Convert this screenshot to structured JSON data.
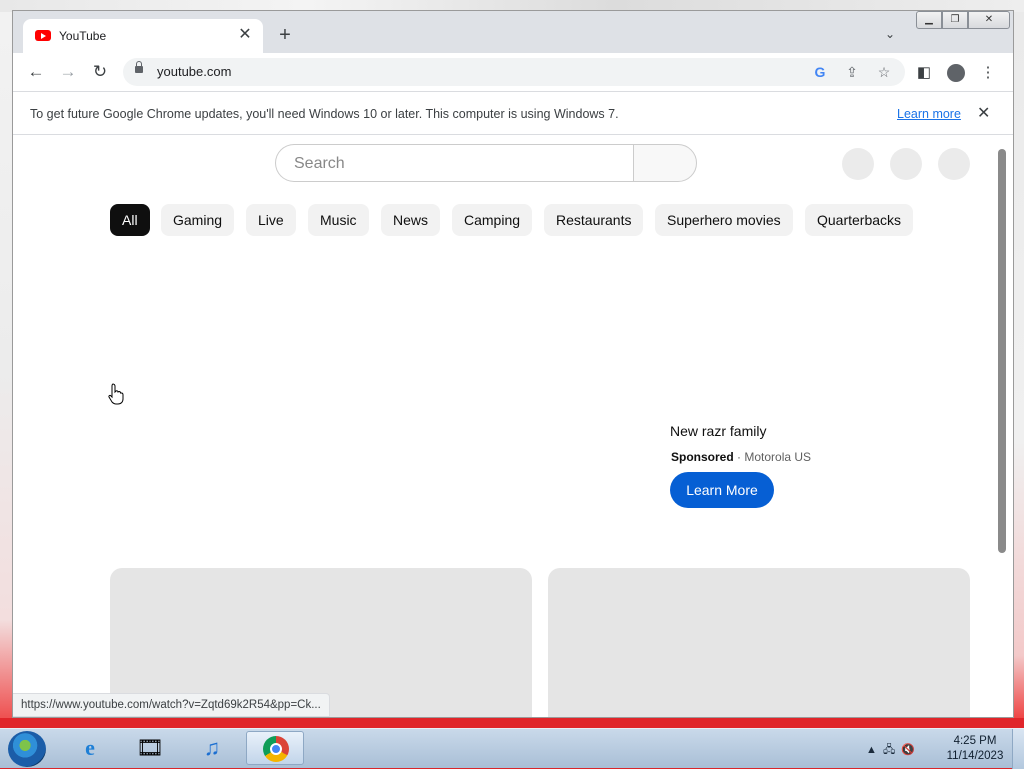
{
  "browser": {
    "tab": {
      "title": "YouTube"
    },
    "address_bar": {
      "url": "youtube.com"
    },
    "infobar": {
      "message": "To get future Google Chrome updates, you'll need Windows 10 or later. This computer is using Windows 7.",
      "link": "Learn more"
    },
    "status_url": "https://www.youtube.com/watch?v=Zqtd69k2R54&pp=Ck..."
  },
  "youtube": {
    "search": {
      "placeholder": "Search",
      "value": ""
    },
    "chips": [
      "All",
      "Gaming",
      "Live",
      "Music",
      "News",
      "Camping",
      "Restaurants",
      "Superhero movies",
      "Quarterbacks"
    ],
    "active_chip": "All",
    "ad": {
      "title": "New razr family",
      "sponsored": "Sponsored",
      "separator": "·",
      "advertiser": "Motorola US",
      "cta": "Learn More"
    }
  },
  "taskbar": {
    "time": "4:25 PM",
    "date": "11/14/2023"
  },
  "colors": {
    "youtube_blue": "#065fd4",
    "chrome_link": "#1a73e8",
    "chip_active_bg": "#0f0f0f",
    "desktop_red": "#d9262b"
  },
  "icons": [
    "youtube-favicon",
    "tab-close-icon",
    "new-tab-icon",
    "tab-search-icon",
    "back-icon",
    "forward-icon",
    "reload-icon",
    "lock-icon",
    "google-lens-icon",
    "share-icon",
    "bookmark-star-icon",
    "side-panel-icon",
    "profile-icon",
    "menu-icon",
    "close-infobar-icon",
    "windows-start-icon",
    "ie-icon",
    "media-icon",
    "itunes-icon",
    "chrome-icon"
  ]
}
